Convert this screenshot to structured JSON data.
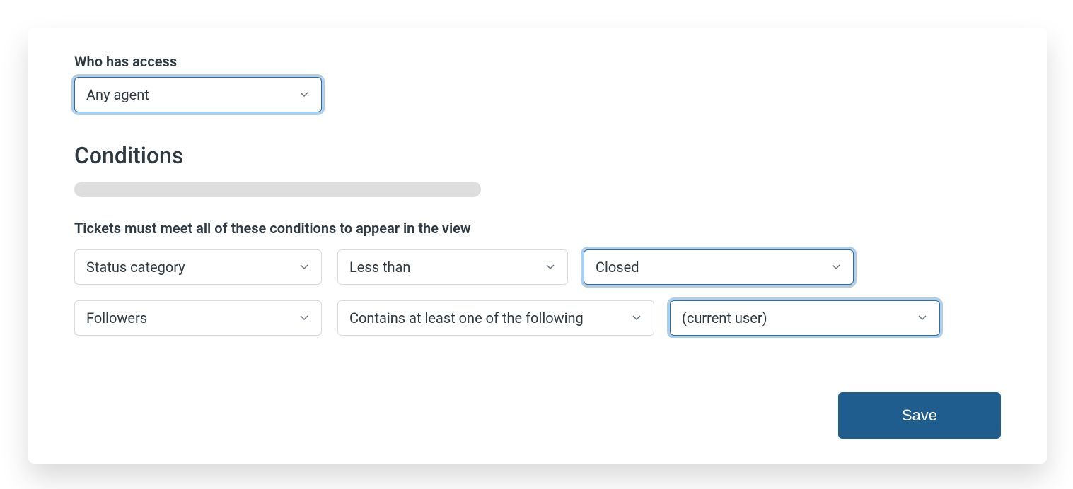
{
  "access": {
    "label": "Who has access",
    "value": "Any agent"
  },
  "conditions": {
    "heading": "Conditions",
    "all_subheading": "Tickets must meet all of these conditions to appear in the view",
    "rows": [
      {
        "field": "Status category",
        "operator": "Less than",
        "value": "Closed"
      },
      {
        "field": "Followers",
        "operator": "Contains at least one of the following",
        "value": "(current user)"
      }
    ]
  },
  "footer": {
    "save_label": "Save"
  }
}
